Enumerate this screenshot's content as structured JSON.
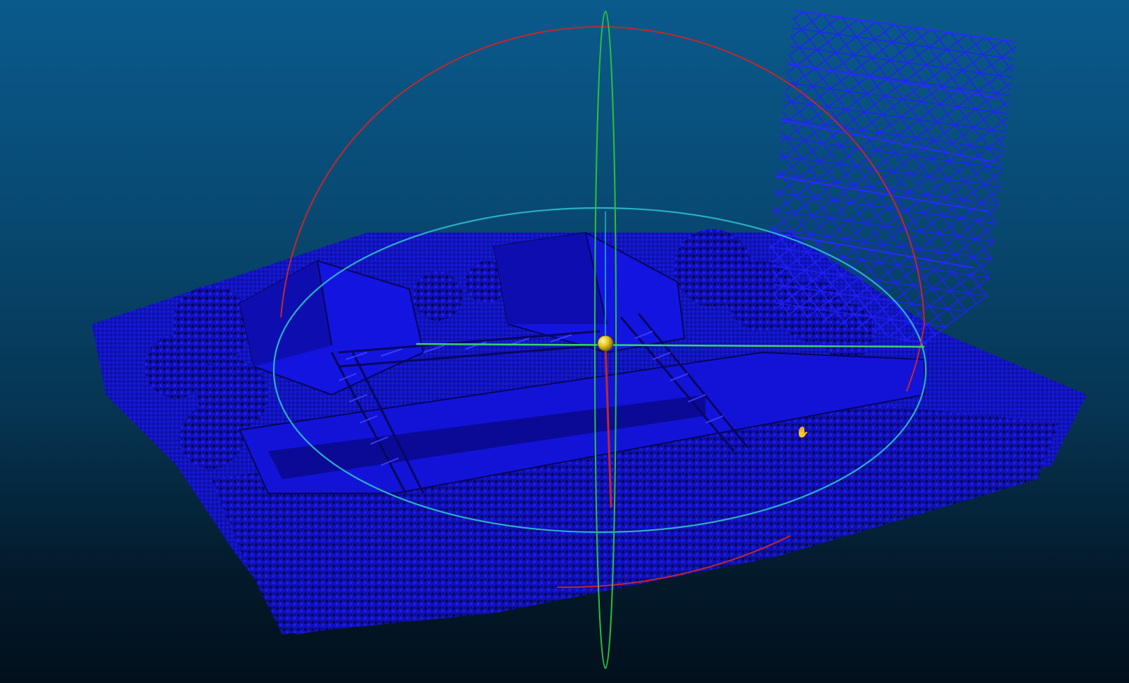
{
  "viewer": {
    "background_top": "#0a5a8c",
    "background_bottom": "#02101c",
    "point_color": "#1616e6",
    "point_color_dark": "#0b0b8a"
  },
  "gizmo": {
    "x_ring_color": "#c0282d",
    "y_ring_color": "#2fbf3a",
    "z_ring_color": "#2ab0c8",
    "center_sphere_color": "#e3c21a",
    "axis_color": "#3ad26a"
  },
  "icons": {
    "cursor": "pan-hand-icon",
    "center": "rotation-center-icon"
  },
  "cursor_glyph": "✋"
}
